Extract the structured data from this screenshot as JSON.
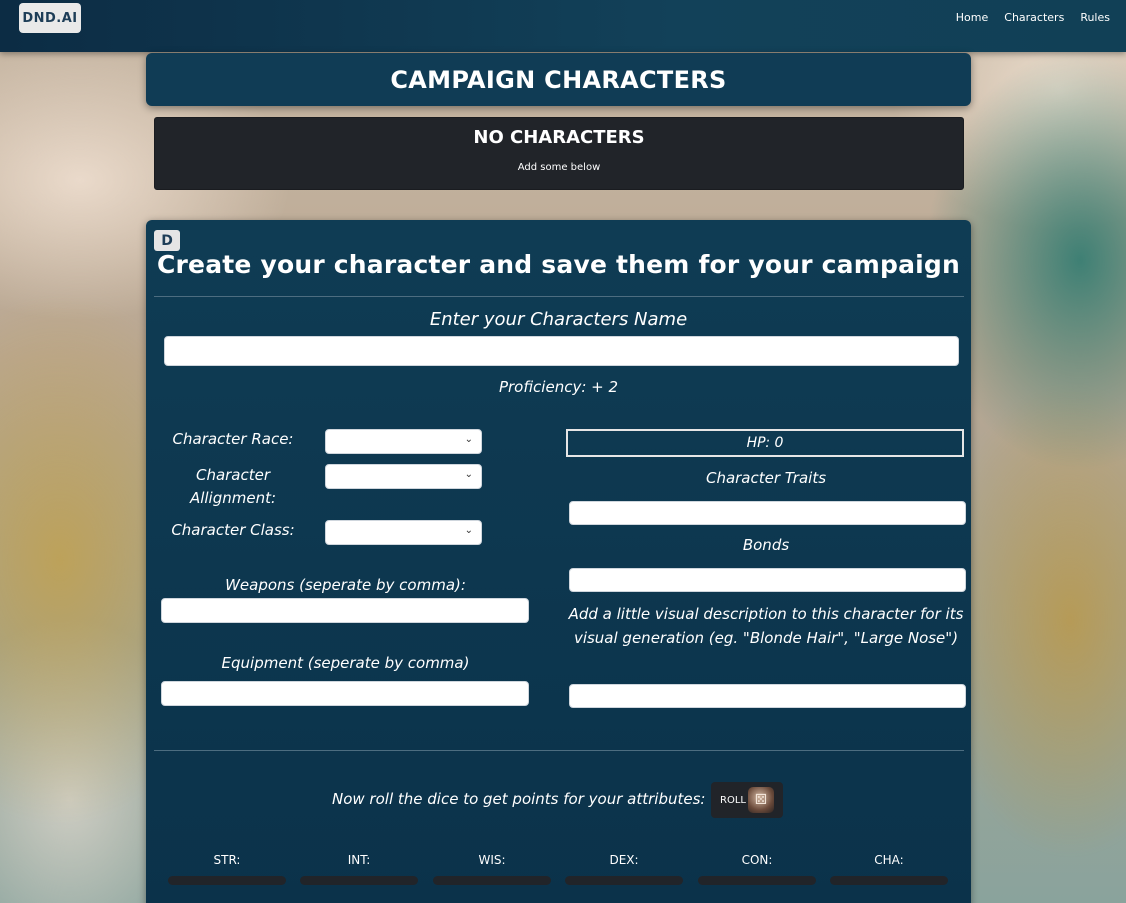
{
  "nav": {
    "logo": "DND.AI",
    "links": [
      "Home",
      "Characters",
      "Rules"
    ]
  },
  "header": {
    "title": "CAMPAIGN CHARACTERS"
  },
  "empty_state": {
    "title": "NO CHARACTERS",
    "subtitle": "Add some below"
  },
  "form": {
    "logo_glyph": "D",
    "title": "Create your character and save them for your campaign",
    "name_label": "Enter your Characters Name",
    "name_value": "",
    "proficiency": "Proficiency: + 2",
    "race_label": "Character Race:",
    "race_value": "",
    "alignment_label": "Character Allignment:",
    "alignment_value": "",
    "class_label": "Character Class:",
    "class_value": "",
    "weapons_label": "Weapons (seperate by comma):",
    "weapons_value": "",
    "equipment_label": "Equipment (seperate by comma)",
    "equipment_value": "",
    "hp": "HP: 0",
    "traits_label": "Character Traits",
    "traits_value": "",
    "bonds_label": "Bonds",
    "bonds_value": "",
    "visual_label": "Add a little visual description to this character for its visual generation (eg. \"Blonde Hair\", \"Large Nose\")",
    "visual_value": "",
    "roll_prompt": "Now roll the dice to get points for your attributes:",
    "roll_label": "ROLL",
    "stats": [
      "STR:",
      "INT:",
      "WIS:",
      "DEX:",
      "CON:",
      "CHA:"
    ]
  },
  "icons": {
    "select_chevron": "chevron-down-icon",
    "dice": "dice-icon"
  }
}
